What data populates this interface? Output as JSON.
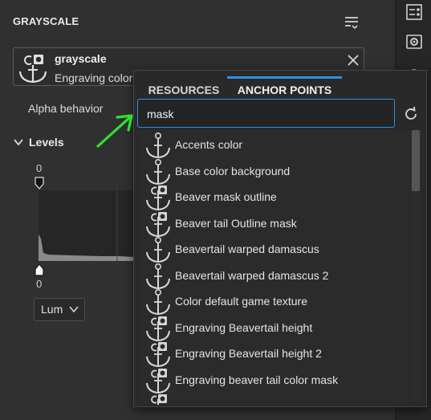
{
  "panel": {
    "title": "GRAYSCALE"
  },
  "resource": {
    "name": "grayscale",
    "subtitle": "Engraving color"
  },
  "alpha_behavior": {
    "label": "Alpha behavior"
  },
  "levels": {
    "label": "Levels",
    "top_value": "0",
    "bottom_value": "0"
  },
  "channel_select": {
    "value": "Lum"
  },
  "popup": {
    "tabs": [
      {
        "label": "RESOURCES",
        "active": false
      },
      {
        "label": "ANCHOR POINTS",
        "active": true
      }
    ],
    "search": {
      "value": "mask"
    },
    "items": [
      {
        "label": "Accents color",
        "icon": "anchor-icon"
      },
      {
        "label": "Base color background",
        "icon": "anchor-icon"
      },
      {
        "label": "Beaver mask outline",
        "icon": "anchor-mask-icon"
      },
      {
        "label": "Beaver tail Outline mask",
        "icon": "anchor-mask-icon"
      },
      {
        "label": "Beavertail warped damascus",
        "icon": "anchor-icon"
      },
      {
        "label": "Beavertail warped damascus 2",
        "icon": "anchor-icon"
      },
      {
        "label": "Color default game texture",
        "icon": "anchor-icon"
      },
      {
        "label": "Engraving Beavertail height",
        "icon": "anchor-mask-icon"
      },
      {
        "label": "Engraving Beavertail height 2",
        "icon": "anchor-mask-icon"
      },
      {
        "label": "Engraving beaver tail color mask",
        "icon": "anchor-mask-icon"
      },
      {
        "label": "",
        "icon": "anchor-mask-icon"
      }
    ]
  },
  "colors": {
    "accent": "#2f8fe8",
    "annotation_arrow": "#2ee02e",
    "background": "#303030"
  }
}
